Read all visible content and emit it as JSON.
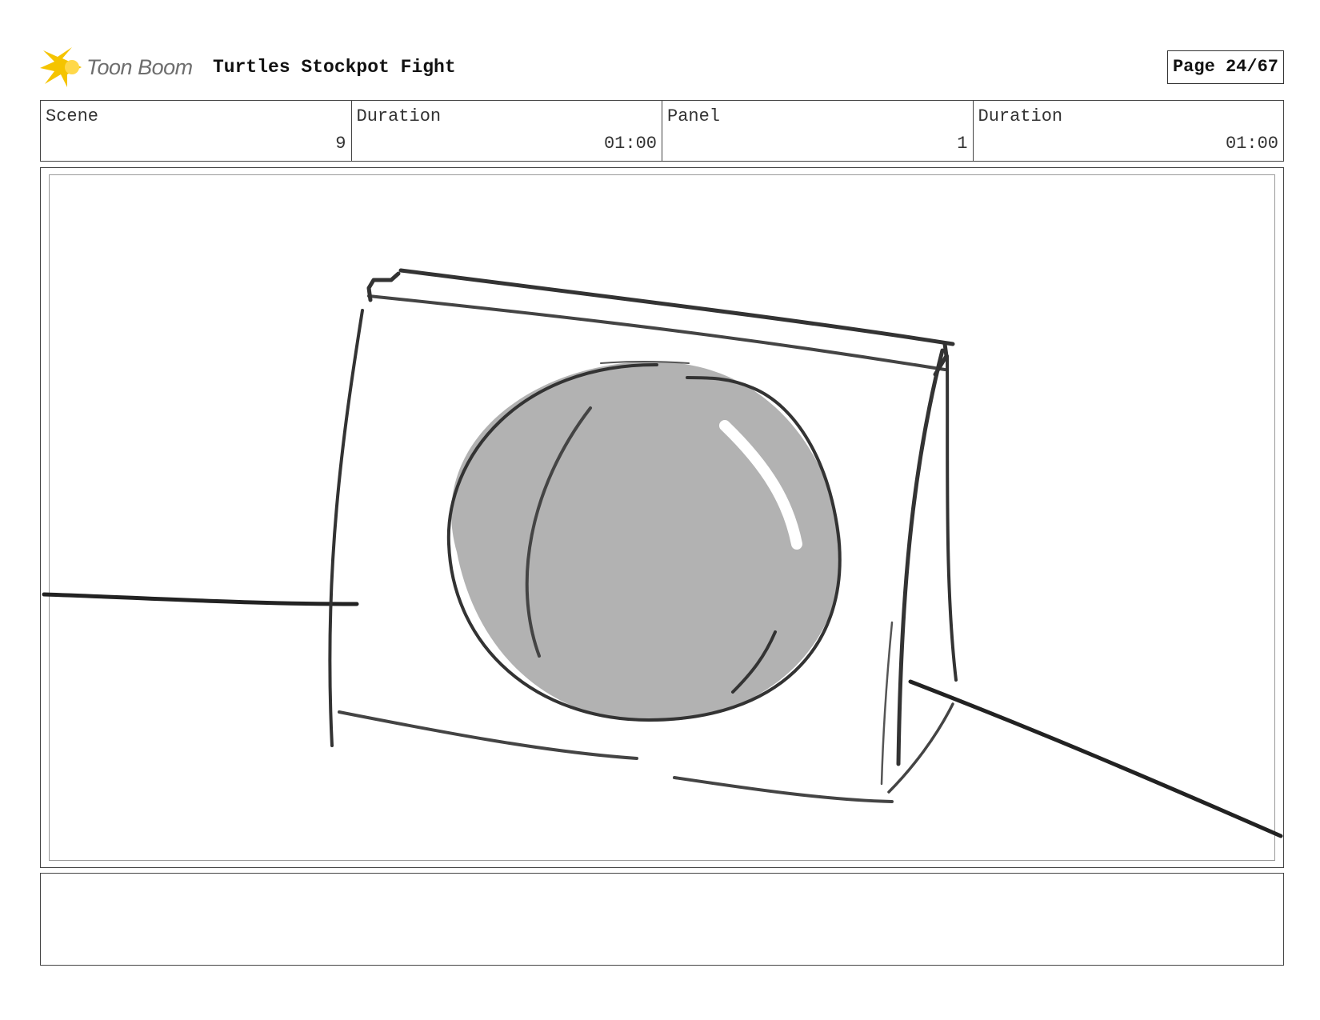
{
  "header": {
    "logo_text": "Toon Boom",
    "project_title": "Turtles Stockpot Fight",
    "page": "Page 24/67"
  },
  "info": [
    {
      "label": "Scene",
      "value": "9"
    },
    {
      "label": "Duration",
      "value": "01:00"
    },
    {
      "label": "Panel",
      "value": "1"
    },
    {
      "label": "Duration",
      "value": "01:00"
    }
  ],
  "notes": {
    "text": ""
  },
  "colors": {
    "logo_star": "#f5c400",
    "logo_text": "#6e6e6e",
    "ball_fill": "#b2b2b2",
    "border": "#444444"
  }
}
